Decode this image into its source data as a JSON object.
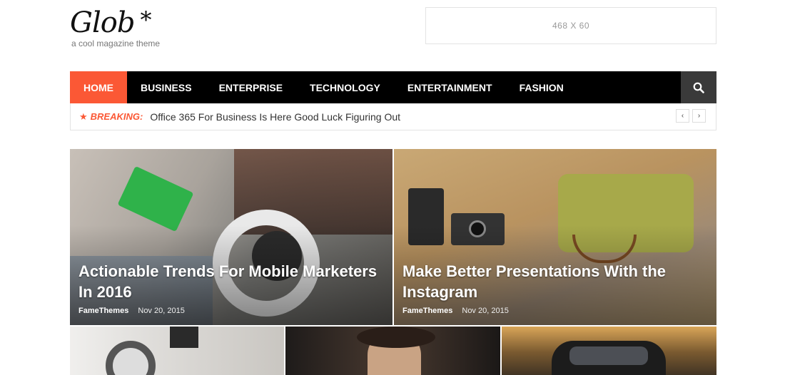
{
  "site": {
    "logo": "Glob",
    "logo_mark": "*",
    "tagline": "a cool magazine theme",
    "ad_text": "468 X 60"
  },
  "nav": {
    "items": [
      {
        "label": "HOME",
        "active": true
      },
      {
        "label": "BUSINESS"
      },
      {
        "label": "ENTERPRISE"
      },
      {
        "label": "TECHNOLOGY"
      },
      {
        "label": "ENTERTAINMENT"
      },
      {
        "label": "FASHION"
      }
    ],
    "search_icon": "search-icon"
  },
  "breaking": {
    "icon": "star-icon",
    "label": "BREAKING:",
    "title": "Office 365 For Business Is Here Good Luck Figuring Out",
    "prev": "‹",
    "next": "›"
  },
  "featured": [
    {
      "title": "Actionable Trends For Mobile Marketers In 2016",
      "author": "FameThemes",
      "date": "Nov 20, 2015"
    },
    {
      "title": "Make Better Presentations With the Instagram",
      "author": "FameThemes",
      "date": "Nov 20, 2015"
    }
  ],
  "colors": {
    "accent": "#fb5835",
    "nav_bg": "#000000",
    "search_bg": "#3a3a3a"
  }
}
